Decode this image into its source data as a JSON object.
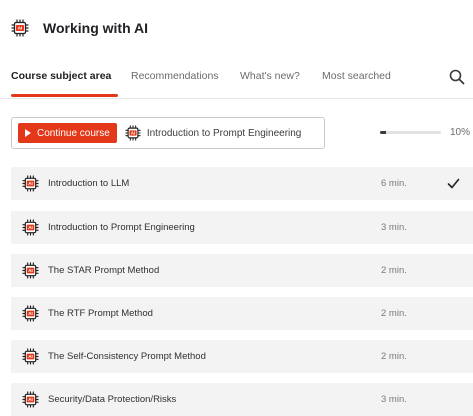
{
  "header": {
    "title": "Working with AI",
    "icon": "ai-chip-icon"
  },
  "tabs": [
    {
      "label": "Course subject area",
      "active": true
    },
    {
      "label": "Recommendations",
      "active": false
    },
    {
      "label": "What's new?",
      "active": false
    },
    {
      "label": "Most searched",
      "active": false
    }
  ],
  "search": {
    "icon": "search-icon"
  },
  "continue_course": {
    "button_label": "Continue course",
    "course_name": "Introduction to Prompt Engineering",
    "progress_percent": 10,
    "progress_text": "10%"
  },
  "lessons": [
    {
      "title": "Introduction to LLM",
      "duration": "6 min.",
      "completed": true
    },
    {
      "title": "Introduction to Prompt Engineering",
      "duration": "3 min.",
      "completed": false
    },
    {
      "title": "The STAR Prompt Method",
      "duration": "2 min.",
      "completed": false
    },
    {
      "title": "The RTF Prompt Method",
      "duration": "2 min.",
      "completed": false
    },
    {
      "title": "The Self-Consistency Prompt Method",
      "duration": "2 min.",
      "completed": false
    },
    {
      "title": "Security/Data Protection/Risks",
      "duration": "3 min.",
      "completed": false
    }
  ],
  "colors": {
    "accent": "#e3391a",
    "row_background": "#f3f3f3",
    "progress_fill": "#3b3b3b"
  }
}
